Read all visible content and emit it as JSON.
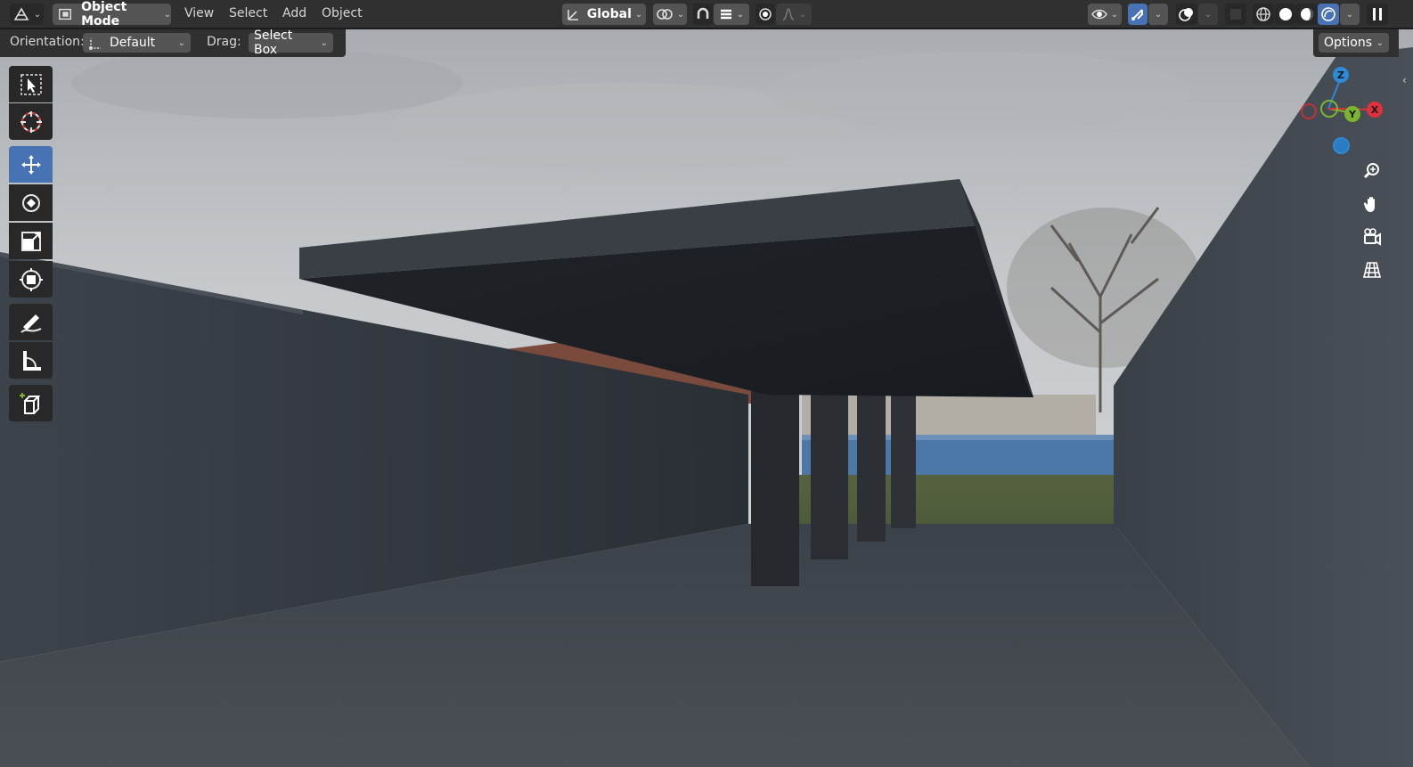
{
  "header": {
    "editor_type_icon": "editor-type-icon",
    "mode": {
      "icon": "object-mode-icon",
      "label": "Object Mode"
    },
    "menus": [
      "View",
      "Select",
      "Add",
      "Object"
    ],
    "transform_orientation": {
      "icon": "orientation-icon",
      "label": "Global"
    },
    "pivot_icon": "pivot-point-icon",
    "snap_icon": "snap-icon",
    "snap_target_icon": "snap-target-icon",
    "proportional_icon": "proportional-editing-icon",
    "falloff_icon": "falloff-icon",
    "visibility_icon": "object-visibility-icon",
    "gizmo_icon": "gizmo-toggle-icon",
    "overlay_icon": "overlays-icon",
    "xray_icon": "xray-icon",
    "shading_modes": [
      "wireframe-icon",
      "solid-icon",
      "material-preview-icon",
      "rendered-icon"
    ],
    "active_shading": "rendered-icon",
    "pause_icon": "pause-icon"
  },
  "tool_settings": {
    "orientation_label": "Orientation:",
    "orientation_value": "Default",
    "drag_label": "Drag:",
    "drag_value": "Select Box",
    "options_label": "Options"
  },
  "toolbar": {
    "tools": [
      {
        "name": "select-box-tool",
        "icon": "select-box-icon",
        "active": false
      },
      {
        "name": "cursor-tool",
        "icon": "cursor-icon",
        "active": false
      },
      {
        "name": "move-tool",
        "icon": "move-icon",
        "active": true
      },
      {
        "name": "rotate-tool",
        "icon": "rotate-icon",
        "active": false
      },
      {
        "name": "scale-tool",
        "icon": "scale-icon",
        "active": false
      },
      {
        "name": "transform-tool",
        "icon": "transform-icon",
        "active": false
      },
      {
        "name": "annotate-tool",
        "icon": "annotate-icon",
        "active": false
      },
      {
        "name": "measure-tool",
        "icon": "measure-icon",
        "active": false
      },
      {
        "name": "add-cube-tool",
        "icon": "add-cube-icon",
        "active": false
      }
    ]
  },
  "gizmo": {
    "z_label": "Z",
    "y_label": "Y",
    "x_label": "X",
    "colors": {
      "x": "#e0303d",
      "y": "#7bb52e",
      "z": "#2d8ad6"
    }
  },
  "nav_buttons": [
    "zoom-icon",
    "pan-hand-icon",
    "camera-view-icon",
    "perspective-grid-icon"
  ],
  "colors": {
    "accent": "#4772b3",
    "header_bg": "#303030",
    "button_bg": "#545454"
  }
}
